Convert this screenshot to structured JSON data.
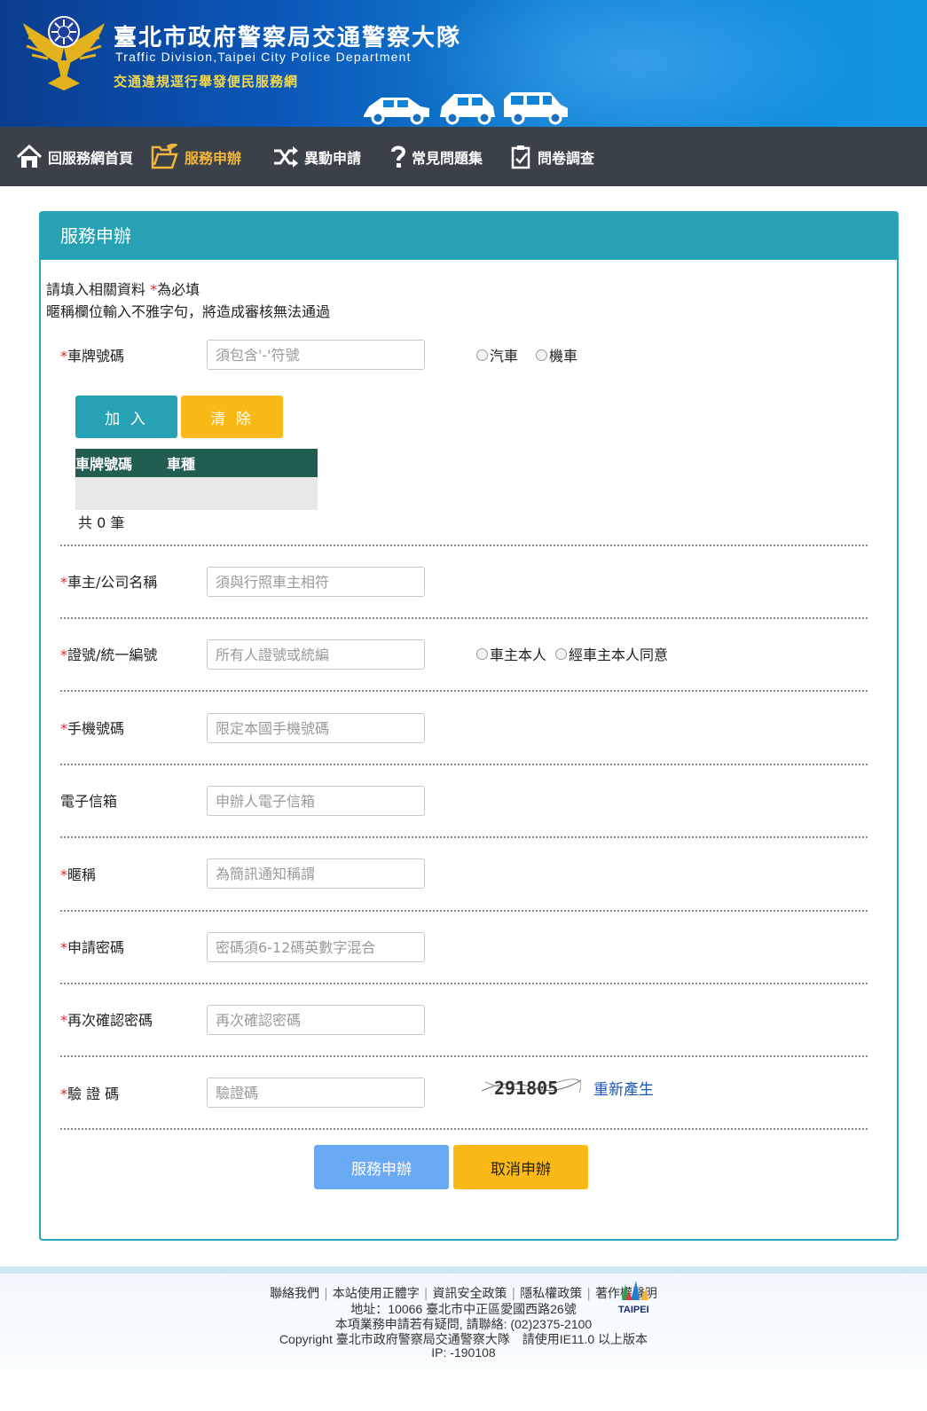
{
  "header": {
    "title_cn": "臺北市政府警察局交通警察大隊",
    "title_en": "Traffic Division,Taipei City Police Department",
    "subtitle": "交通違規逕行舉發便民服務網"
  },
  "nav": {
    "items": [
      {
        "label": "回服務網首頁",
        "icon": "home-icon"
      },
      {
        "label": "服務申辦",
        "icon": "folder-pen-icon",
        "active": true
      },
      {
        "label": "異動申請",
        "icon": "shuffle-icon"
      },
      {
        "label": "常見問題集",
        "icon": "question-icon"
      },
      {
        "label": "問卷調查",
        "icon": "clipboard-icon"
      }
    ]
  },
  "panel": {
    "title": "服務申辦",
    "intro_line1_prefix": "請填入相關資料 ",
    "intro_required_mark": "*",
    "intro_line1_suffix": "為必填",
    "intro_line2": "暱稱欄位輸入不雅字句，將造成審核無法通過"
  },
  "form": {
    "plate": {
      "star": "*",
      "label": "車牌號碼",
      "placeholder": "須包含'-'符號",
      "options": [
        "汽車",
        "機車"
      ]
    },
    "add_button": "加 入",
    "clear_button": "清 除",
    "plate_table": {
      "headers": [
        "車牌號碼",
        "車種"
      ],
      "rows": []
    },
    "count_text": "共 0 筆",
    "owner": {
      "star": "*",
      "label": "車主/公司名稱",
      "placeholder": "須與行照車主相符"
    },
    "id_number": {
      "star": "*",
      "label": "證號/統一編號",
      "placeholder": "所有人證號或統編",
      "options": [
        "車主本人",
        "經車主本人同意"
      ]
    },
    "mobile": {
      "star": "*",
      "label": "手機號碼",
      "placeholder": "限定本國手機號碼"
    },
    "email": {
      "label": "電子信箱",
      "placeholder": "申辦人電子信箱"
    },
    "nickname": {
      "star": "*",
      "label": "暱稱",
      "placeholder": "為簡訊通知稱謂"
    },
    "password": {
      "star": "*",
      "label": "申請密碼",
      "placeholder": "密碼須6-12碼英數字混合"
    },
    "password_confirm": {
      "star": "*",
      "label": "再次確認密碼",
      "placeholder": "再次確認密碼"
    },
    "captcha": {
      "star": "*",
      "label": "驗 證 碼",
      "placeholder": "驗證碼",
      "image_text": "291805",
      "regenerate": "重新產生"
    },
    "submit_button": "服務申辦",
    "cancel_button": "取消申辦"
  },
  "footer": {
    "links": [
      "聯絡我們",
      "本站使用正體字",
      "資訊安全政策",
      "隱私權政策",
      "著作權聲明"
    ],
    "address": "地址：10066 臺北市中正區愛國西路26號",
    "contact": "本項業務申請若有疑問, 請聯絡: (02)2375-2100",
    "copyright": "Copyright 臺北市政府警察局交通警察大隊　請使用IE11.0 以上版本",
    "ip": "IP: -190108",
    "logo_text": "TAIPEI"
  },
  "colors": {
    "teal": "#27a2b5",
    "yellow": "#fbb918",
    "nav_bg": "#3b4148",
    "nav_active": "#f3b63c",
    "submit_blue": "#6aaaf5",
    "table_header": "#225d52",
    "required": "#d9262c",
    "link_blue": "#1b57b5"
  }
}
